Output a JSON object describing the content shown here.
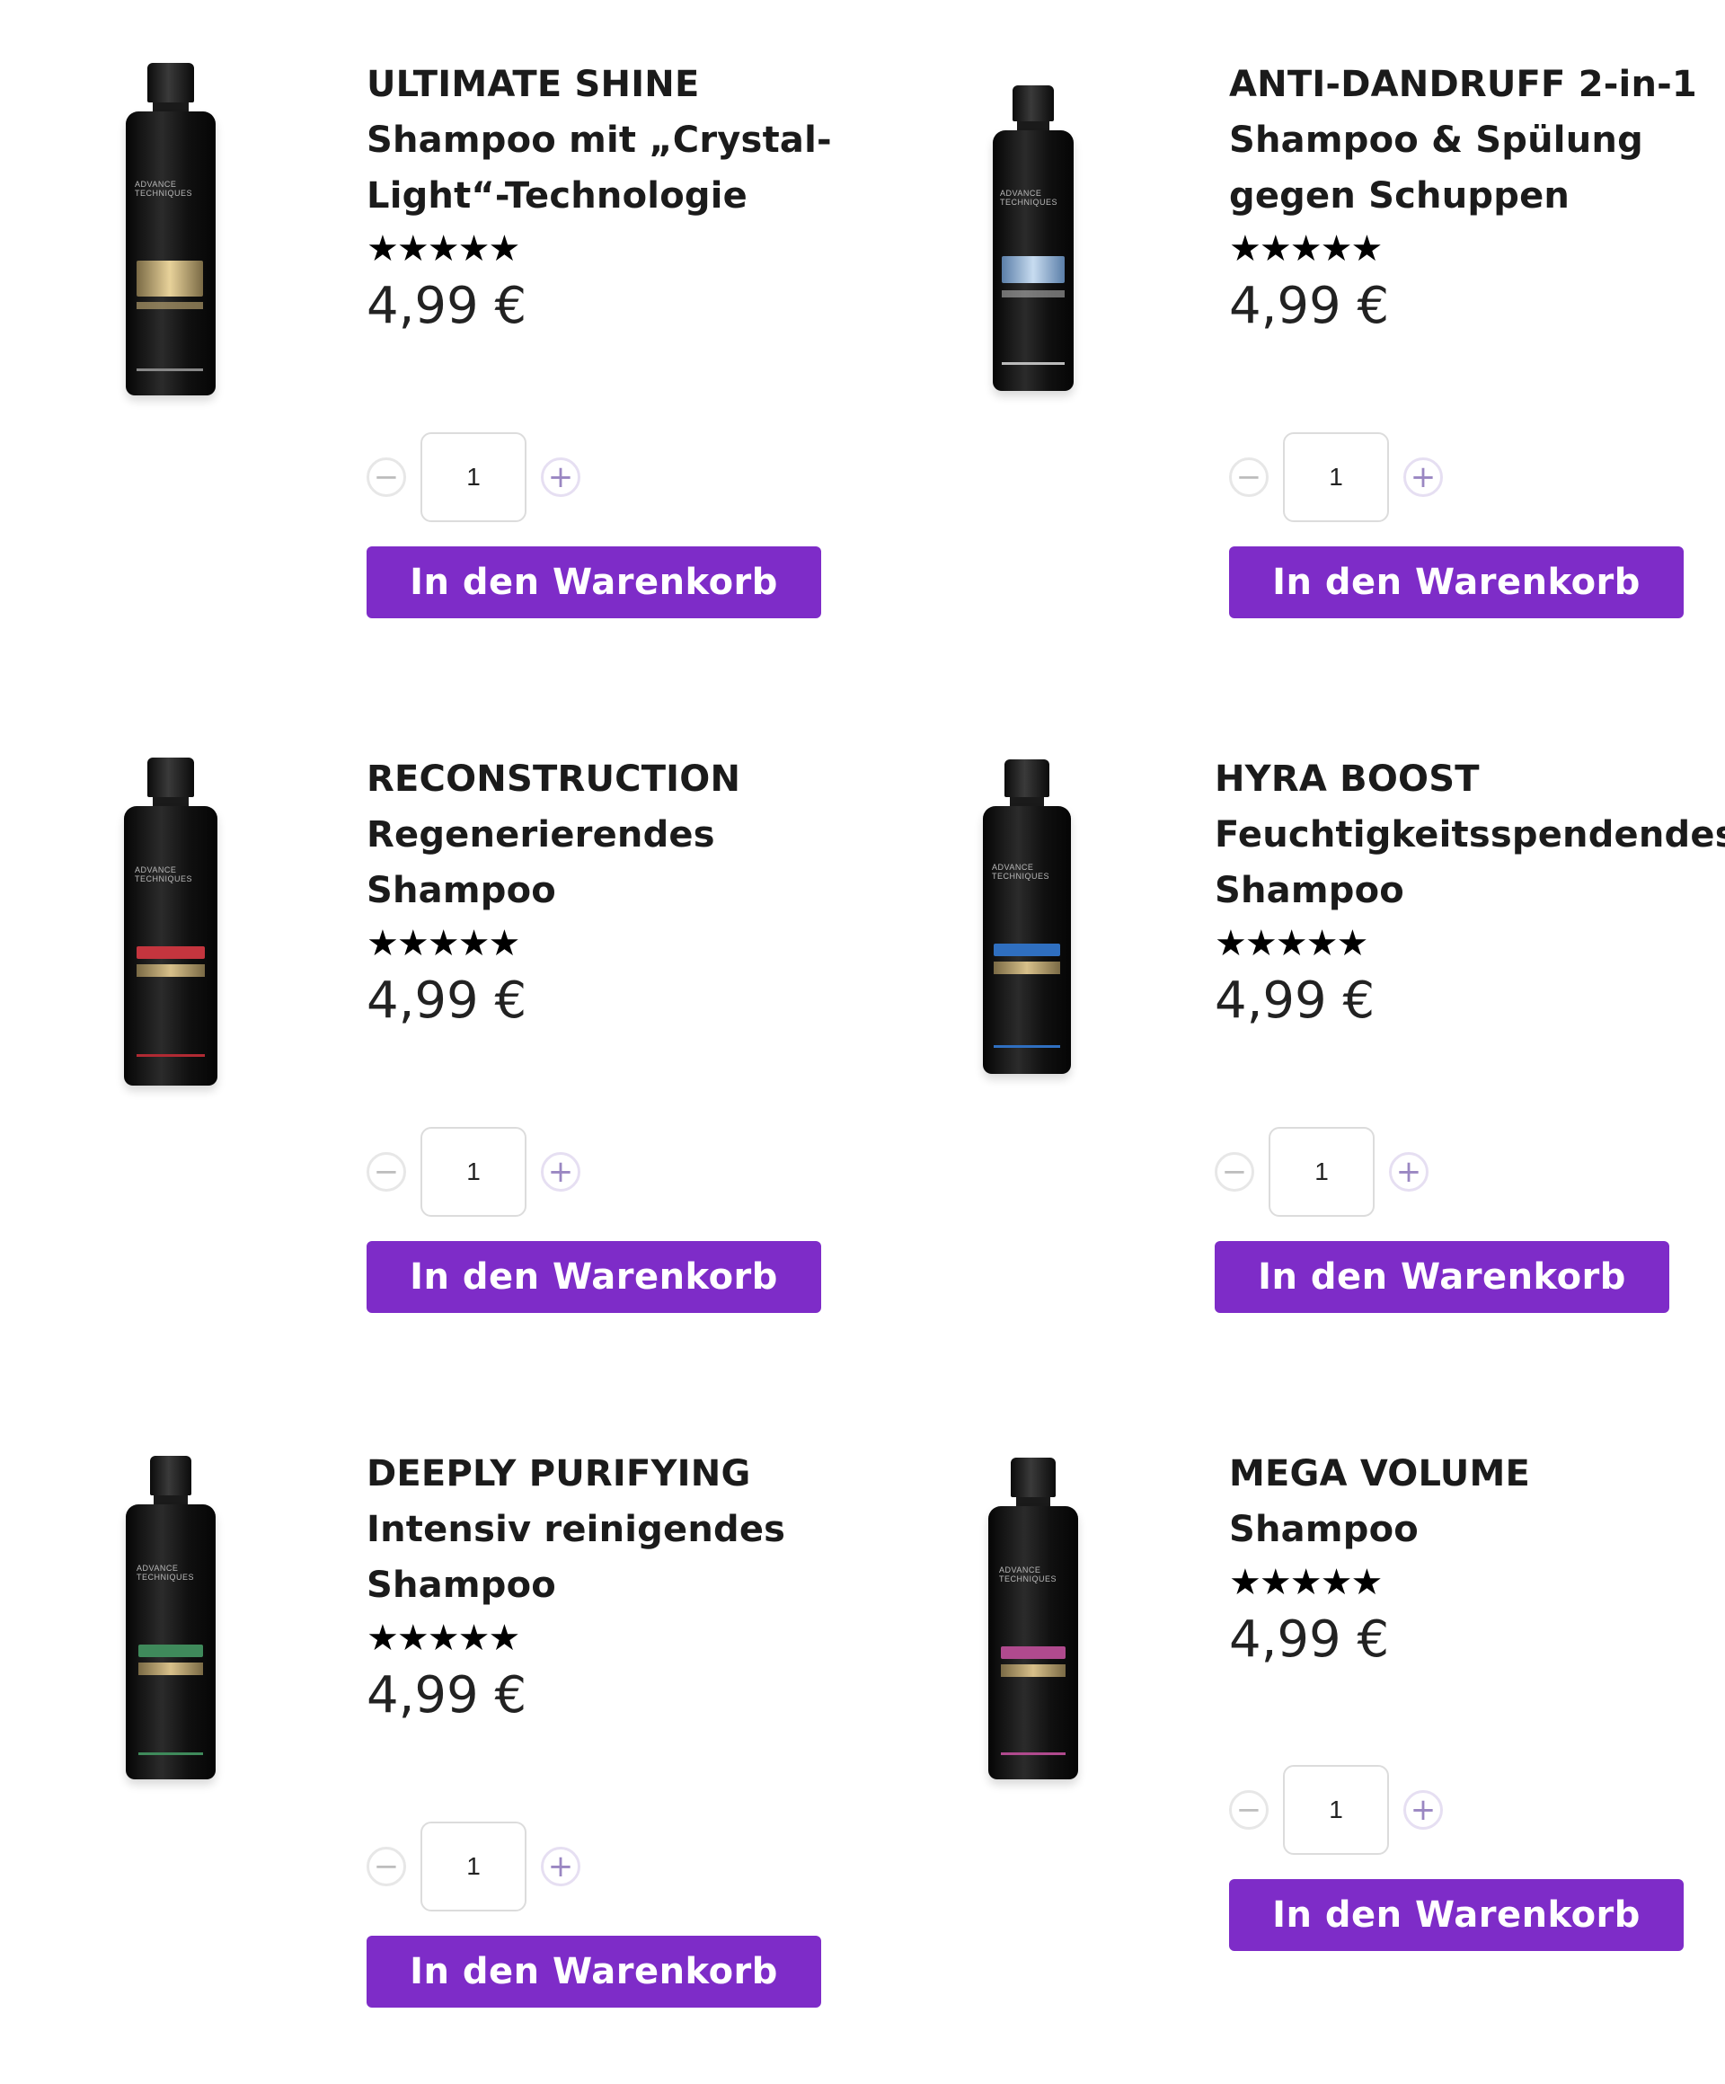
{
  "colors": {
    "accent": "#7e2cc8",
    "text": "#1b1b1b"
  },
  "icons": {
    "minus": "minus-circle-icon",
    "plus": "plus-circle-icon"
  },
  "products": [
    {
      "line1": "ULTIMATE SHINE",
      "line2": "Shampoo mit „Crystal-",
      "line3": "Light“-Technologie",
      "stars": "★★★★★",
      "rating": 5,
      "price": "4,99 €",
      "quantity": "1",
      "cart_label": "In den Warenkorb",
      "bottle_brand": "ADVANCE TECHNIQUES",
      "bottle_accent": "#c9a24c"
    },
    {
      "line1": "ANTI-DANDRUFF 2-in-1",
      "line2": "Shampoo & Spülung",
      "line3": "gegen Schuppen",
      "stars": "★★★★★",
      "rating": 5,
      "price": "4,99 €",
      "quantity": "1",
      "cart_label": "In den Warenkorb",
      "bottle_brand": "ADVANCE TECHNIQUES",
      "bottle_accent": "#8fb3dc"
    },
    {
      "line1": "RECONSTRUCTION",
      "line2": "Regenerierendes",
      "line3": "Shampoo",
      "stars": "★★★★★",
      "rating": 5,
      "price": "4,99 €",
      "quantity": "1",
      "cart_label": "In den Warenkorb",
      "bottle_brand": "ADVANCE TECHNIQUES",
      "bottle_accent": "#c4353e"
    },
    {
      "line1": "HYRA BOOST",
      "line2": "Feuchtigkeitsspendendes",
      "line3": "Shampoo",
      "stars": "★★★★★",
      "rating": 4.5,
      "price": "4,99 €",
      "quantity": "1",
      "cart_label": "In den Warenkorb",
      "bottle_brand": "ADVANCE TECHNIQUES",
      "bottle_accent": "#2f6fc0"
    },
    {
      "line1": "DEEPLY PURIFYING",
      "line2": "Intensiv reinigendes",
      "line3": "Shampoo",
      "stars": "★★★★★",
      "rating": 5,
      "price": "4,99 €",
      "quantity": "1",
      "cart_label": "In den Warenkorb",
      "bottle_brand": "ADVANCE TECHNIQUES",
      "bottle_accent": "#3f8a5b"
    },
    {
      "line1": "MEGA VOLUME",
      "line2": "Shampoo",
      "line3": "",
      "stars": "★★★★★",
      "rating": 5,
      "price": "4,99 €",
      "quantity": "1",
      "cart_label": "In den Warenkorb",
      "bottle_brand": "ADVANCE TECHNIQUES",
      "bottle_accent": "#b04a8e"
    }
  ]
}
